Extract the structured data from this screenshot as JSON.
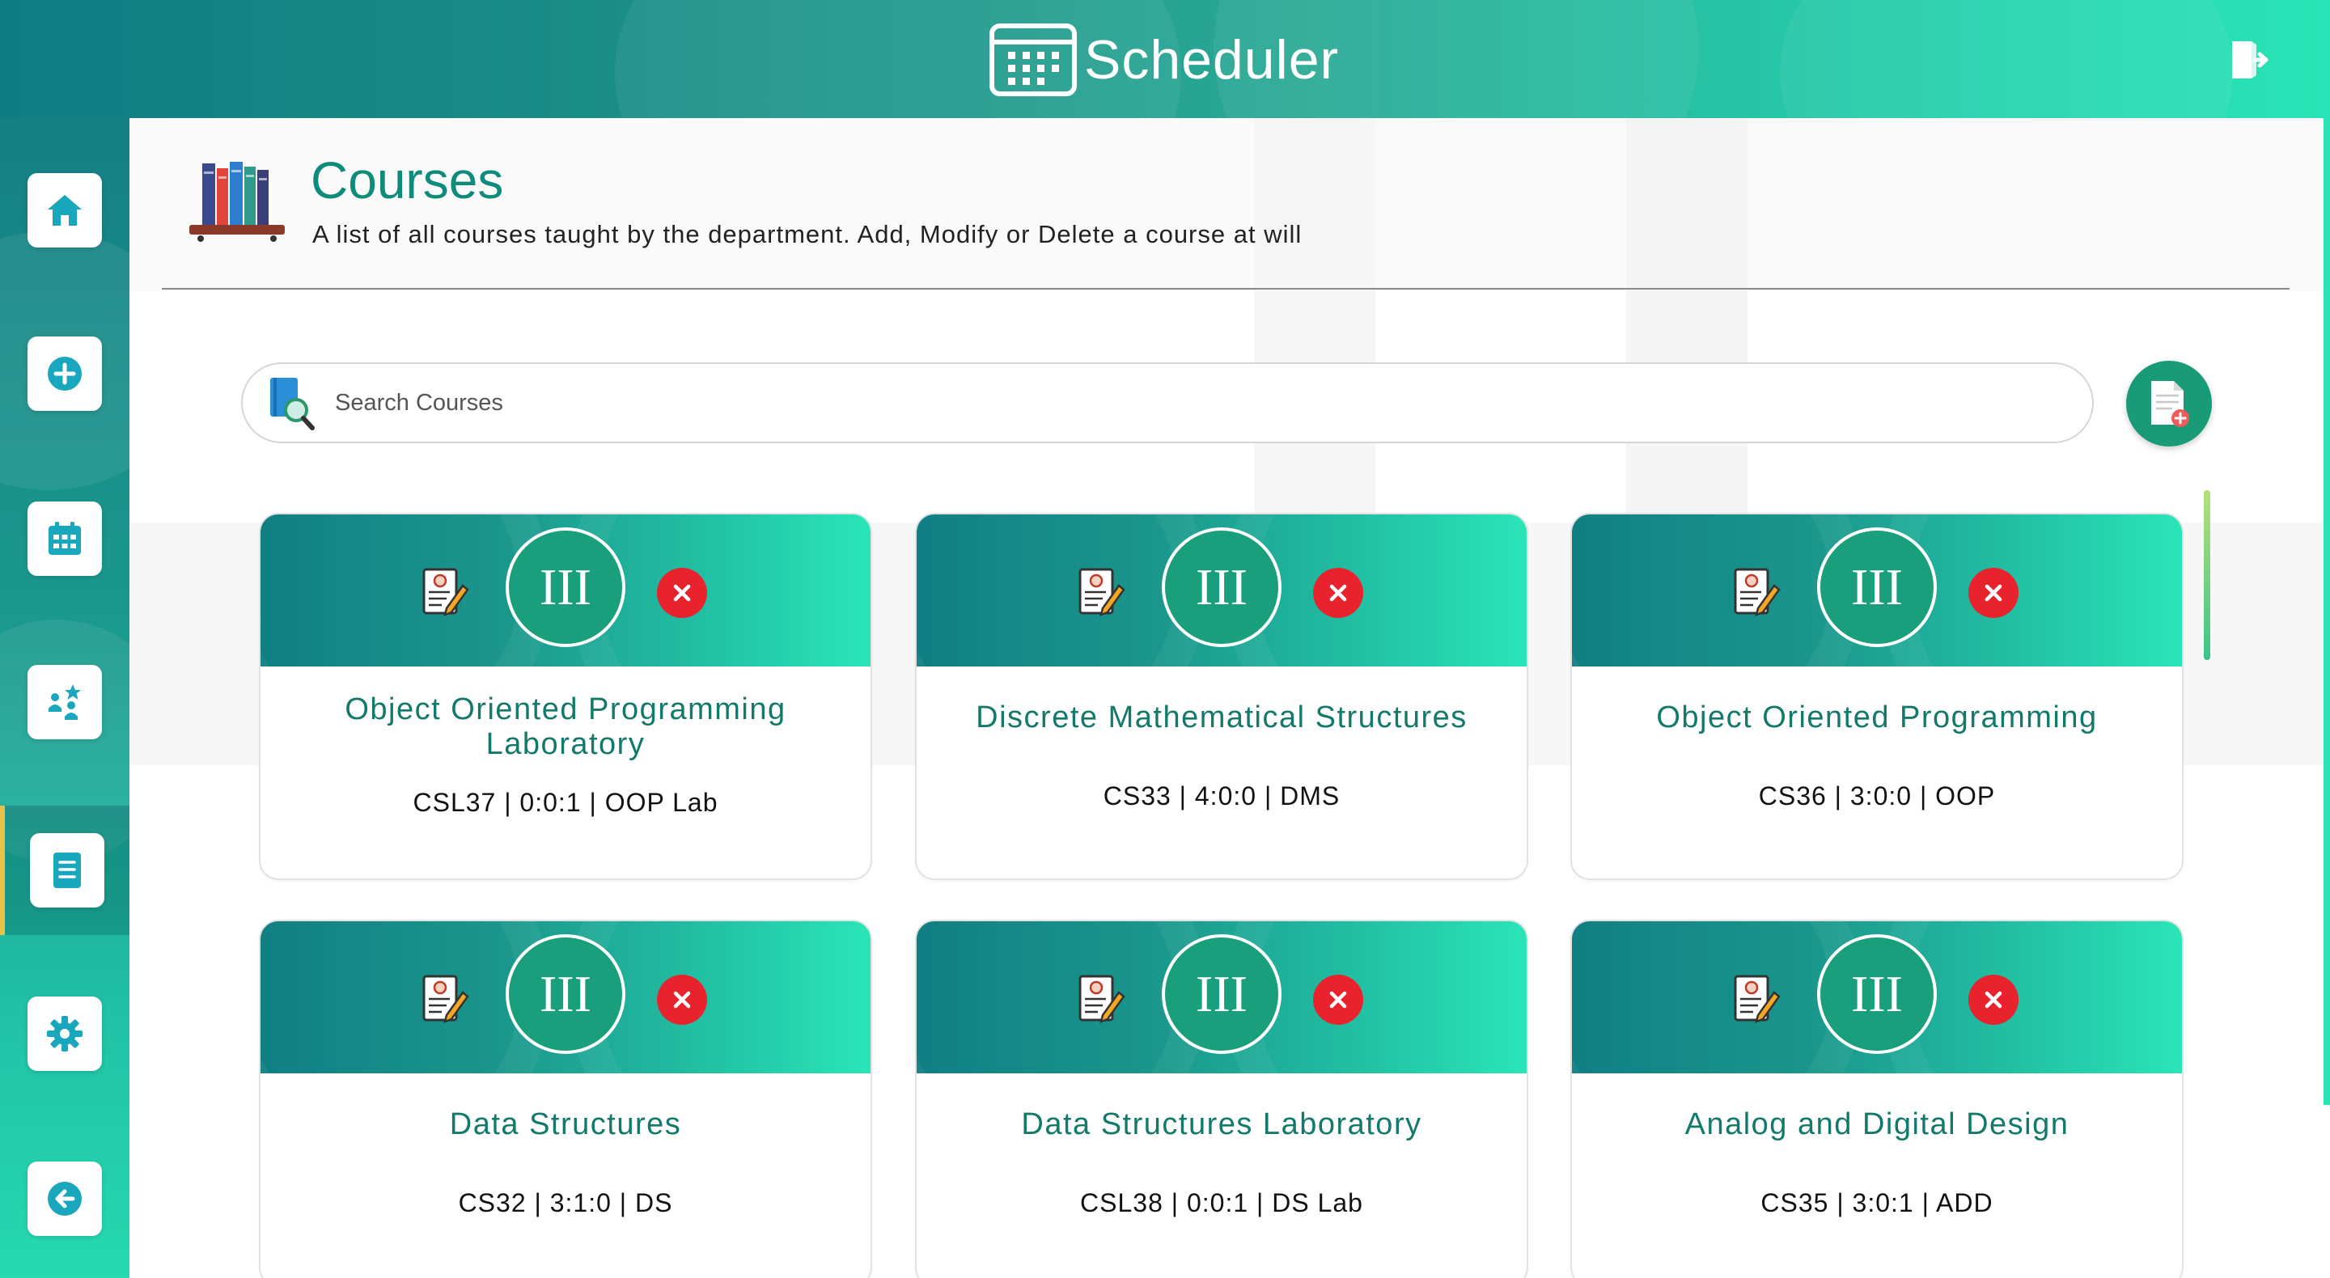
{
  "app": {
    "title": "Scheduler",
    "brand_icon": "calendar-grid-icon",
    "logout_icon": "logout-door-icon"
  },
  "sidebar": {
    "items": [
      {
        "name": "home",
        "icon": "home-icon"
      },
      {
        "name": "add",
        "icon": "plus-circle-icon"
      },
      {
        "name": "calendar",
        "icon": "calendar-icon"
      },
      {
        "name": "faculty",
        "icon": "people-star-icon"
      },
      {
        "name": "courses",
        "icon": "notebook-icon",
        "active": true
      },
      {
        "name": "settings",
        "icon": "gear-icon"
      },
      {
        "name": "back",
        "icon": "back-arrow-icon"
      }
    ]
  },
  "page": {
    "title": "Courses",
    "subtitle": "A list of all courses taught by the department. Add, Modify or Delete a course at will",
    "header_icon": "bookshelf-icon"
  },
  "search": {
    "placeholder": "Search Courses",
    "value": "",
    "icon": "book-search-icon"
  },
  "add_button": {
    "icon": "add-document-icon"
  },
  "courses": [
    {
      "semester": "III",
      "name": "Object Oriented Programming Laboratory",
      "meta": "CSL37 | 0:0:1 | OOP Lab"
    },
    {
      "semester": "III",
      "name": "Discrete Mathematical Structures",
      "meta": "CS33 | 4:0:0 | DMS"
    },
    {
      "semester": "III",
      "name": "Object Oriented Programming",
      "meta": "CS36 | 3:0:0 | OOP"
    },
    {
      "semester": "III",
      "name": "Data Structures",
      "meta": "CS32 | 3:1:0 | DS"
    },
    {
      "semester": "III",
      "name": "Data Structures Laboratory",
      "meta": "CSL38 | 0:0:1 | DS Lab"
    },
    {
      "semester": "III",
      "name": "Analog and Digital Design",
      "meta": "CS35 | 3:0:1 | ADD"
    }
  ],
  "colors": {
    "accent_teal": "#1a9f7c",
    "title_teal": "#0e8b7a",
    "delete_red": "#e8232e",
    "active_marker": "#e6c24a"
  }
}
